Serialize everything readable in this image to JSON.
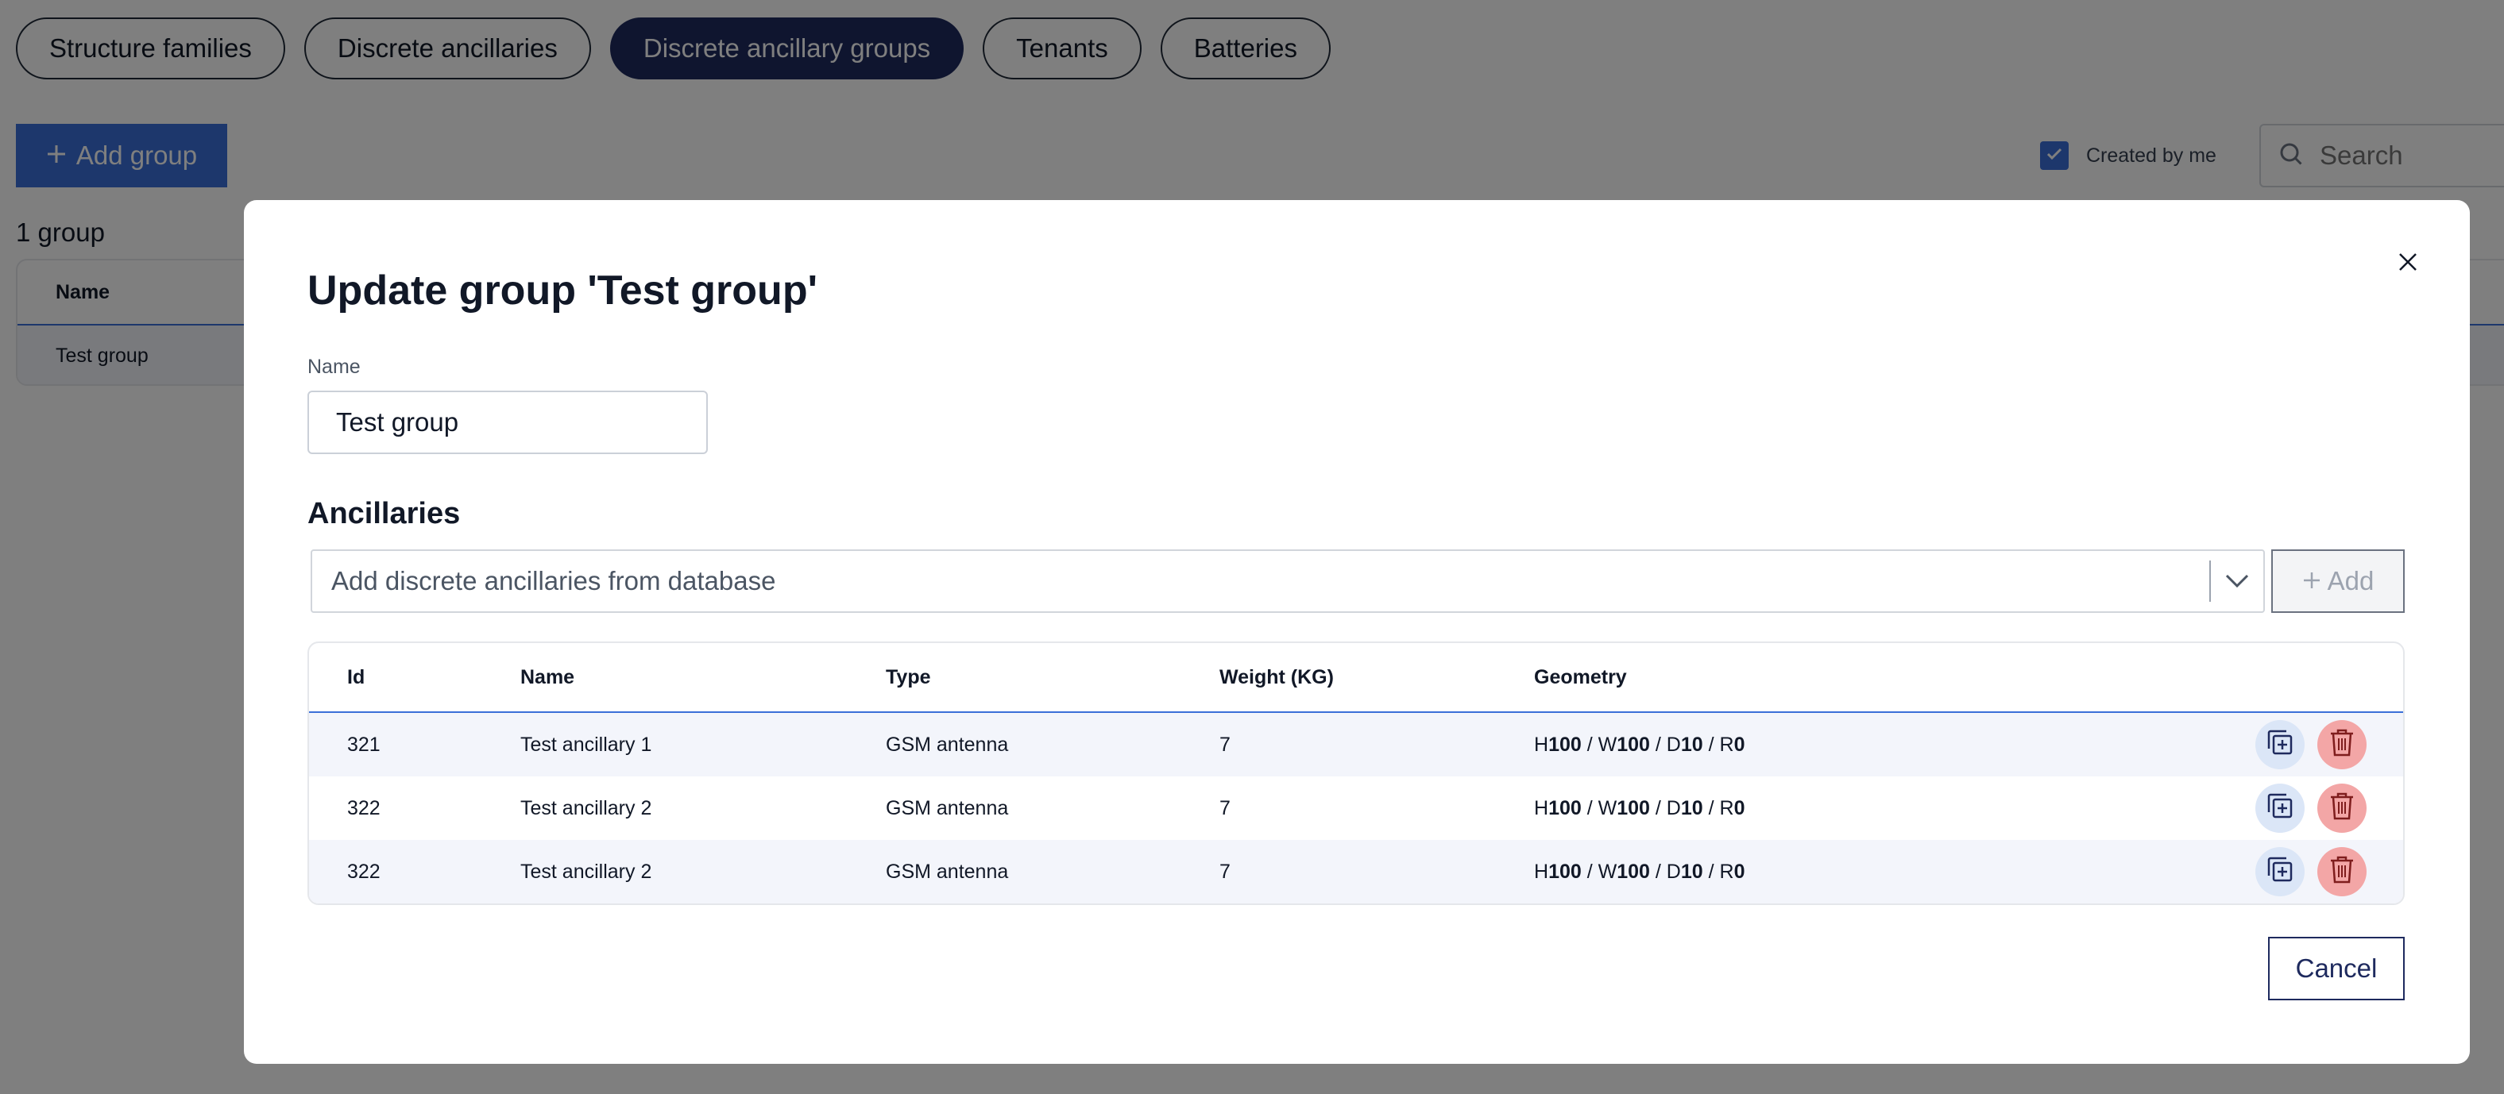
{
  "tabs": [
    {
      "label": "Structure families",
      "active": false
    },
    {
      "label": "Discrete ancillaries",
      "active": false
    },
    {
      "label": "Discrete ancillary groups",
      "active": true
    },
    {
      "label": "Tenants",
      "active": false
    },
    {
      "label": "Batteries",
      "active": false
    }
  ],
  "toolbar": {
    "add_group_label": "Add group",
    "created_by_me_label": "Created by me",
    "created_by_me_checked": true,
    "search_placeholder": "Search"
  },
  "list": {
    "count_label": "1 group",
    "header_name": "Name",
    "rows": [
      "Test group"
    ]
  },
  "modal": {
    "title": "Update group 'Test group'",
    "name_label": "Name",
    "name_value": "Test group",
    "section_title": "Ancillaries",
    "select_placeholder": "Add discrete ancillaries from database",
    "add_label": "Add",
    "cancel_label": "Cancel",
    "table": {
      "headers": {
        "id": "Id",
        "name": "Name",
        "type": "Type",
        "weight": "Weight (KG)",
        "geometry": "Geometry"
      },
      "rows": [
        {
          "id": "321",
          "name": "Test ancillary 1",
          "type": "GSM antenna",
          "weight": "7",
          "geometry": {
            "h": "100",
            "w": "100",
            "d": "10",
            "r": "0"
          }
        },
        {
          "id": "322",
          "name": "Test ancillary 2",
          "type": "GSM antenna",
          "weight": "7",
          "geometry": {
            "h": "100",
            "w": "100",
            "d": "10",
            "r": "0"
          }
        },
        {
          "id": "322",
          "name": "Test ancillary 2",
          "type": "GSM antenna",
          "weight": "7",
          "geometry": {
            "h": "100",
            "w": "100",
            "d": "10",
            "r": "0"
          }
        }
      ]
    }
  },
  "colors": {
    "accent": "#3a6fd8",
    "navy": "#1e2a5e",
    "delete_bg": "#f3a6a6",
    "duplicate_bg": "#dbe6f7"
  },
  "icons": [
    "plus-icon",
    "check-icon",
    "search-icon",
    "close-icon",
    "chevron-down-icon",
    "duplicate-icon",
    "trash-icon"
  ]
}
